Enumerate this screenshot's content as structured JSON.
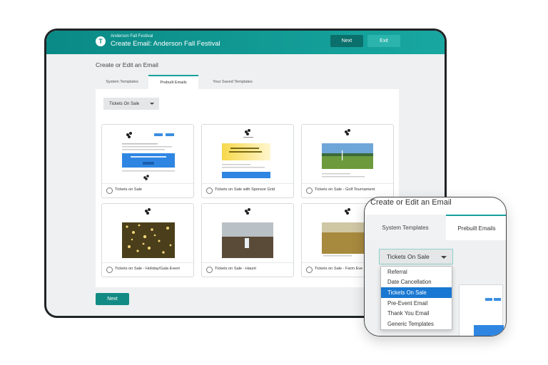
{
  "header": {
    "logo_letter": "T",
    "event_name": "Anderson Fall Festival",
    "title": "Create Email: Anderson Fall Festival",
    "next_label": "Next",
    "exit_label": "Exit"
  },
  "page": {
    "heading": "Create or Edit an Email",
    "tabs": [
      {
        "label": "System Templates",
        "active": false
      },
      {
        "label": "Prebuilt Emails",
        "active": true
      },
      {
        "label": "Your Saved Templates",
        "active": false
      }
    ],
    "filter": {
      "selected": "Tickets On Sale"
    },
    "templates": [
      {
        "label": "Tickets on Sale"
      },
      {
        "label": "Tickets on Sale with Sponsor Grid"
      },
      {
        "label": "Tickets on Sale - Golf Tournament"
      },
      {
        "label": "Tickets on Sale - Holiday/Gala Event"
      },
      {
        "label": "Tickets on Sale - Haunt"
      },
      {
        "label": "Tickets on Sale - Farm Eve"
      }
    ],
    "next_label": "Next"
  },
  "zoom": {
    "heading": "Create or Edit an Email",
    "tabs": [
      {
        "label": "System Templates",
        "active": false
      },
      {
        "label": "Prebuilt Emails",
        "active": true
      }
    ],
    "select_value": "Tickets On Sale",
    "options": [
      {
        "label": "Referral",
        "selected": false
      },
      {
        "label": "Date Cancellation",
        "selected": false
      },
      {
        "label": "Tickets On Sale",
        "selected": true
      },
      {
        "label": "Pre-Event Email",
        "selected": false
      },
      {
        "label": "Thank You Email",
        "selected": false
      },
      {
        "label": "Generic Templates",
        "selected": false
      }
    ]
  },
  "colors": {
    "brand_teal": "#15a19b",
    "header_dark": "#0b6f6b",
    "selected_option": "#1a78d2"
  }
}
